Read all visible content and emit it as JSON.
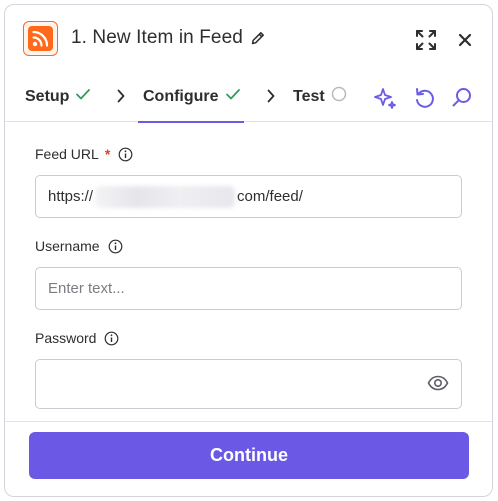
{
  "header": {
    "title": "1. New Item in Feed",
    "app_icon": "rss-icon",
    "accent": "#ff6a1a"
  },
  "tabs": [
    {
      "label": "Setup",
      "status": "complete"
    },
    {
      "label": "Configure",
      "status": "complete",
      "active": true
    },
    {
      "label": "Test",
      "status": "pending"
    }
  ],
  "fields": {
    "feed_url": {
      "label": "Feed URL",
      "required_mark": "*",
      "value_prefix": "https://",
      "value_suffix": "com/feed/"
    },
    "username": {
      "label": "Username",
      "placeholder": "Enter text..."
    },
    "password": {
      "label": "Password",
      "value": ""
    }
  },
  "footer": {
    "continue_label": "Continue",
    "button_color": "#6b59e6"
  },
  "colors": {
    "check": "#2f9e5b",
    "active_tab_underline": "#6b5ce7",
    "tool_icon": "#6b5ce7"
  }
}
